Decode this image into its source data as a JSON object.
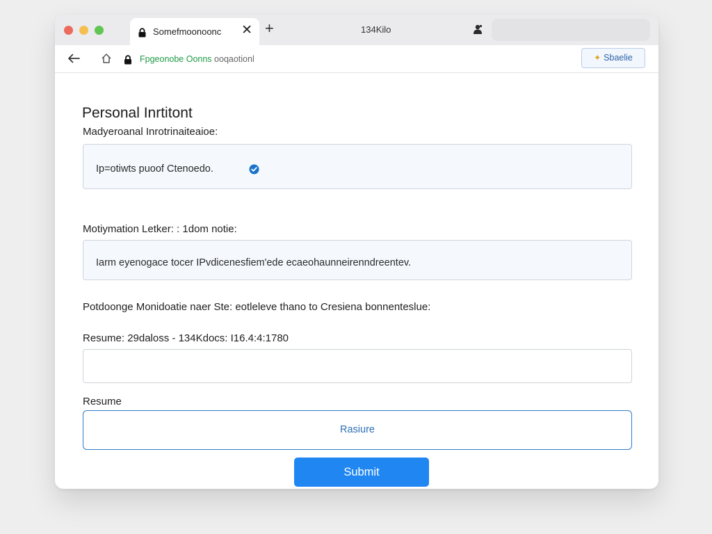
{
  "browser": {
    "tab_title": "Somefmoonoonc",
    "tab_close": "✕",
    "new_tab": "+",
    "tabbar_center": "134Kilo",
    "address_host": "Fpgeonobe Oonns",
    "address_path": "ooqaotionl",
    "share_label": "Sbaelie"
  },
  "form": {
    "title": "Personal Inrtitont",
    "field1_label": "Madyeroanal Inrotrinaiteaioe:",
    "field1_value": "Ip=otiwts puoof Ctenoedo.",
    "field2_label": "Motiymation Letker:  :  1dom notie:",
    "field2_value": "Iarm eyenogace tocer IPvdicenesfiem'ede ecaeohaunneirenndreentev.",
    "note": "Potdoonge Monidoatie naer Ste: eotleleve thano to Cresiena bonnenteslue:",
    "resume_info_label": "Resume: 29daloss  - 134Kdocs:  I16.4:4:1780",
    "resume_input_value": "",
    "resume_label": "Resume",
    "resume_button": "Rasiure",
    "submit_button": "Submit"
  },
  "colors": {
    "accent": "#1f86f2",
    "address_host": "#1f9a45",
    "check_badge": "#1a73c9"
  },
  "icons": {
    "tab": "lock-icon",
    "tabbar": "extension-icon",
    "back": "back-arrow-icon",
    "home": "home-icon",
    "address": "lock-icon",
    "share": "sparkle-icon",
    "field1_badge": "check-badge-icon"
  }
}
